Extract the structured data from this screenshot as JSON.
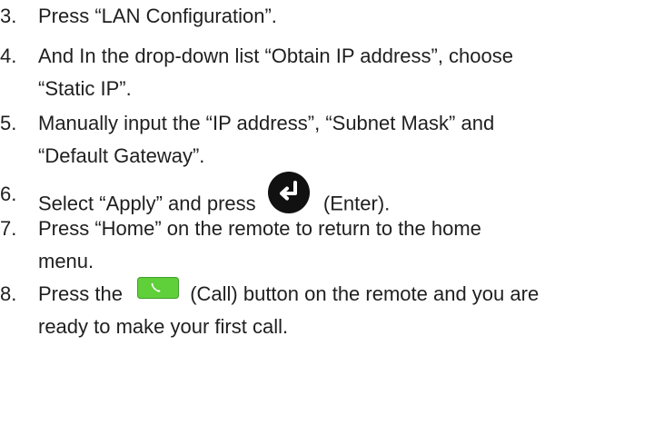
{
  "steps": [
    {
      "number": "3.",
      "line1": "Press “LAN Configuration”."
    },
    {
      "number": "4.",
      "line1": "And In the drop-down list “Obtain IP address”, choose",
      "line2": "“Static IP”."
    },
    {
      "number": "5.",
      "line1": "Manually input the “IP address”, “Subnet Mask” and",
      "line2": "“Default Gateway”."
    },
    {
      "number": "6.",
      "before_icon": "Select “Apply” and press",
      "icon": "enter-key-icon",
      "after_icon": "(Enter)."
    },
    {
      "number": "7.",
      "line1": "Press “Home” on the remote to return to the home",
      "line2": "menu."
    },
    {
      "number": "8.",
      "before_icon": "Press the",
      "icon": "call-button-icon",
      "after_icon": "(Call) button on the remote and you are",
      "line2": "ready to make your first call."
    }
  ],
  "colors": {
    "text": "#1f1f1f",
    "enter_icon_fill": "#111111",
    "call_icon_fill": "#5fcf3a",
    "call_icon_border": "#3f9f2a"
  }
}
